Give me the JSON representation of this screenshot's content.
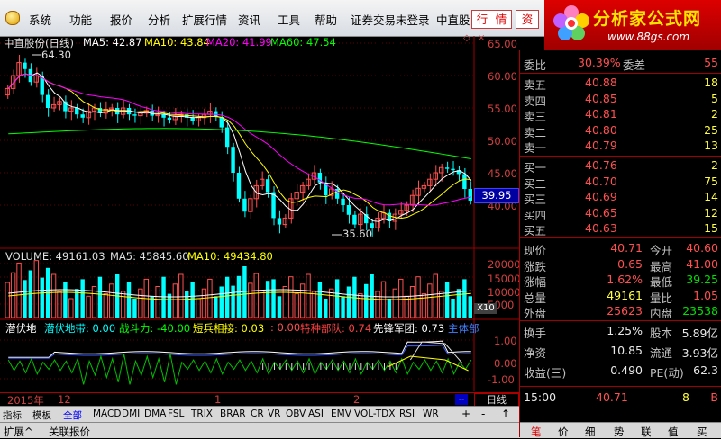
{
  "menu": {
    "items": [
      "系统",
      "功能",
      "报价",
      "分析",
      "扩展行情",
      "资讯",
      "工具",
      "帮助",
      "证券交易未登录",
      "中直股"
    ],
    "quote_buttons": [
      "行",
      "情",
      "资"
    ],
    "window_buttons": [
      "_",
      "□",
      "×"
    ]
  },
  "logo": {
    "title": "分析家公式网",
    "url": "www.88gs.com"
  },
  "chart": {
    "title": "中直股份(日线)",
    "ma": [
      {
        "label": "MA5: 42.87",
        "color": "#ffffff"
      },
      {
        "label": "MA10: 43.84",
        "color": "#ffff00"
      },
      {
        "label": "MA20: 41.99",
        "color": "#ff00ff"
      },
      {
        "label": "MA60: 47.54",
        "color": "#00ff00"
      }
    ],
    "y_ticks": [
      "65.00",
      "60.00",
      "55.00",
      "50.00",
      "45.00",
      "40.00"
    ],
    "high_label": "64.30",
    "low_label": "35.60",
    "current_price": "39.95",
    "volume_header": {
      "volume": "VOLUME: 49161.03",
      "ma5": "MA5: 45845.60",
      "ma10": "MA10: 49434.80"
    },
    "vol_ticks": [
      "20000",
      "15000",
      "10000",
      "5000"
    ],
    "vol_unit": "X10",
    "indicator_header": {
      "name": "潜伏地",
      "l1": "潜伏地带: 0.00",
      "l2": "战斗力: -40.00",
      "l3": "短兵相接: 0.03",
      "l4": ": 0.00",
      "l5": "特种部队: 0.74",
      "l6": "先锋军团: 0.73",
      "l7": "主体部"
    },
    "ind_ticks": [
      "1.00",
      "0.00",
      "-1.00"
    ],
    "date_labels": [
      "2015年",
      "12",
      "1",
      "2"
    ],
    "period": "日线"
  },
  "tabs": [
    "指标",
    "模板",
    "全部",
    "MACD",
    "DMI",
    "DMA",
    "FSL",
    "TRIX",
    "BRAR",
    "CR",
    "VR",
    "OBV",
    "ASI",
    "EMV",
    "VOL-TDX",
    "RSI",
    "WR"
  ],
  "tab_controls": [
    "+",
    "-",
    "↑"
  ],
  "status_tabs": [
    "扩展^",
    "关联报价"
  ],
  "quote": {
    "weibi": {
      "label": "委比",
      "value": "30.39%",
      "label2": "委差",
      "value2": "55"
    },
    "sell": [
      {
        "label": "卖五",
        "price": "40.88",
        "vol": "18"
      },
      {
        "label": "卖四",
        "price": "40.85",
        "vol": "5"
      },
      {
        "label": "卖三",
        "price": "40.81",
        "vol": "2"
      },
      {
        "label": "卖二",
        "price": "40.80",
        "vol": "25"
      },
      {
        "label": "卖一",
        "price": "40.79",
        "vol": "13"
      }
    ],
    "buy": [
      {
        "label": "买一",
        "price": "40.76",
        "vol": "2"
      },
      {
        "label": "买二",
        "price": "40.70",
        "vol": "75"
      },
      {
        "label": "买三",
        "price": "40.69",
        "vol": "14"
      },
      {
        "label": "买四",
        "price": "40.65",
        "vol": "12"
      },
      {
        "label": "买五",
        "price": "40.63",
        "vol": "15"
      }
    ],
    "stats": [
      {
        "l1": "现价",
        "v1": "40.71",
        "c1": "red",
        "l2": "今开",
        "v2": "40.60",
        "c2": "red"
      },
      {
        "l1": "涨跌",
        "v1": "0.65",
        "c1": "red",
        "l2": "最高",
        "v2": "41.00",
        "c2": "red"
      },
      {
        "l1": "涨幅",
        "v1": "1.62%",
        "c1": "red",
        "l2": "最低",
        "v2": "39.25",
        "c2": "green"
      },
      {
        "l1": "总量",
        "v1": "49161",
        "c1": "yellow",
        "l2": "量比",
        "v2": "1.05",
        "c2": "red"
      },
      {
        "l1": "外盘",
        "v1": "25623",
        "c1": "red",
        "l2": "内盘",
        "v2": "23538",
        "c2": "green"
      }
    ],
    "stats2": [
      {
        "l1": "换手",
        "v1": "1.25%",
        "l2": "股本",
        "v2": "5.89亿"
      },
      {
        "l1": "净资",
        "v1": "10.85",
        "l2": "流通",
        "v2": "3.93亿"
      },
      {
        "l1": "收益(三)",
        "v1": "0.490",
        "l2": "PE(动)",
        "v2": "62.3"
      }
    ],
    "tick": {
      "time": "15:00",
      "price": "40.71",
      "vol": "8",
      "dir": "B"
    },
    "bottom_tabs": [
      "笔",
      "价",
      "细",
      "势",
      "联",
      "值",
      "买"
    ]
  },
  "colors": {
    "up": "#ff5050",
    "down": "#00ffff",
    "ma5": "#ffffff",
    "ma10": "#ffff00",
    "ma20": "#ff00ff",
    "ma60": "#00ff00"
  }
}
